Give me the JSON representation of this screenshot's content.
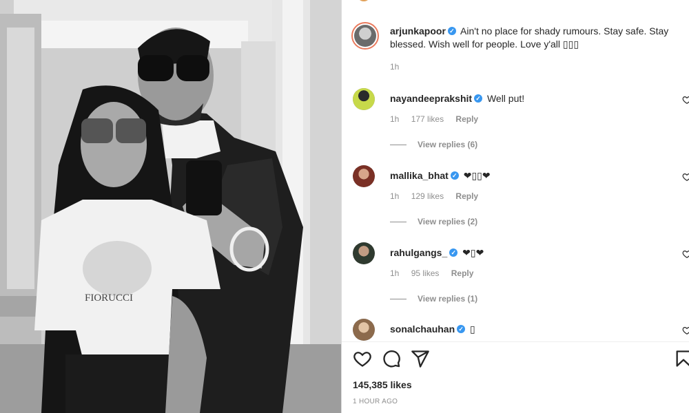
{
  "post": {
    "author": "arjunkapoor",
    "caption": "Ain't no place for shady rumours. Stay safe. Stay blessed. Wish well for people. Love y'all ▯▯▯",
    "time": "1h",
    "likes": "145,385 likes",
    "posted_ago": "1 HOUR AGO"
  },
  "comments": [
    {
      "username": "nayandeeprakshit",
      "text": "Well put!",
      "time": "1h",
      "likes": "177 likes",
      "reply": "Reply",
      "view_replies": "View replies (6)"
    },
    {
      "username": "mallika_bhat",
      "text": "❤▯▯❤",
      "time": "1h",
      "likes": "129 likes",
      "reply": "Reply",
      "view_replies": "View replies (2)"
    },
    {
      "username": "rahulgangs_",
      "text": "❤▯❤",
      "time": "1h",
      "likes": "95 likes",
      "reply": "Reply",
      "view_replies": "View replies (1)"
    },
    {
      "username": "sonalchauhan",
      "text": "▯"
    }
  ],
  "icons": {
    "like": "heart-icon",
    "comment": "comment-icon",
    "share": "paper-plane-icon",
    "save": "bookmark-icon",
    "verified": "verified-badge-icon"
  },
  "colors": {
    "verified": "#3897f0",
    "text": "#262626",
    "muted": "#8e8e8e",
    "story_ring": "#e97a5d"
  }
}
